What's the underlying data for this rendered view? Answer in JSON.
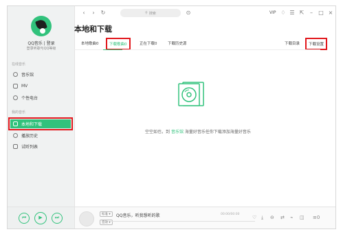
{
  "topbar": {
    "back": "‹",
    "forward": "›",
    "refresh": "↻",
    "search_placeholder": "搜索",
    "history": "⊙",
    "vip": "VIP",
    "skin": "♢",
    "menu": "☰",
    "mini": "⇱",
    "minimize": "–",
    "maximize": "□",
    "close": "×"
  },
  "sidebar": {
    "user_name": "QQ音乐 | 登录",
    "user_sub": "登录听歌与QQ等级",
    "online_title": "在线音乐",
    "online_items": [
      {
        "label": "音乐馆",
        "icon": "music-hall-icon"
      },
      {
        "label": "MV",
        "icon": "mv-icon"
      },
      {
        "label": "个性电台",
        "icon": "radio-icon"
      }
    ],
    "my_title": "我的音乐",
    "my_items": [
      {
        "label": "本地和下载",
        "icon": "local-download-icon"
      },
      {
        "label": "播放历史",
        "icon": "history-icon"
      },
      {
        "label": "试听列表",
        "icon": "playlist-icon"
      }
    ]
  },
  "main": {
    "title": "本地和下载",
    "tabs": [
      {
        "label": "本地歌曲0"
      },
      {
        "label": "下载歌曲0"
      },
      {
        "label": "正在下载0"
      },
      {
        "label": "下载历史源"
      }
    ],
    "right_links": [
      {
        "label": "下载目录"
      },
      {
        "label": "下载设置"
      }
    ],
    "empty_prefix": "空空如也，到",
    "empty_link": "音乐馆",
    "empty_suffix": "海量好音乐任你下载添加海量好音乐"
  },
  "player": {
    "prev": "⏮",
    "play": "▶",
    "next": "⏭",
    "tag_quality": "标准 ▾",
    "tag_mode": "音效 ▾",
    "song": "QQ音乐，听我想听的歌",
    "time": "00:00/00:00",
    "icons": [
      "♡",
      "⤓",
      "⊖",
      "⇄",
      "⌁",
      "◫",
      "≡0"
    ]
  },
  "colors": {
    "accent": "#31c27c",
    "highlight": "#e1161b"
  }
}
